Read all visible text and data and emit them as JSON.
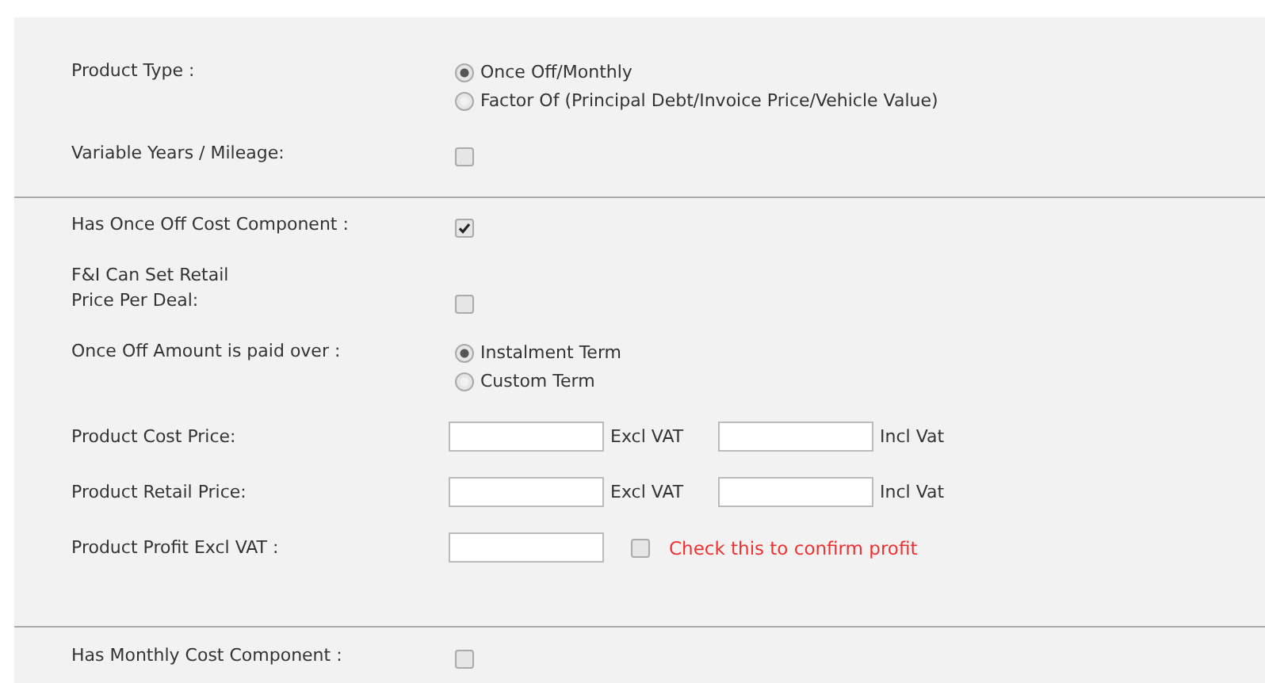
{
  "sections": [
    {
      "rows": [
        {
          "kind": "radio",
          "label": "Product Type :",
          "options": [
            {
              "label": "Once Off/Monthly",
              "selected": true
            },
            {
              "label": "Factor Of (Principal Debt/Invoice Price/Vehicle Value)",
              "selected": false
            }
          ]
        },
        {
          "kind": "checkbox",
          "label": "Variable Years / Mileage:",
          "checked": false
        }
      ]
    },
    {
      "rows": [
        {
          "kind": "checkbox",
          "label": "Has Once Off Cost Component :",
          "checked": true
        },
        {
          "kind": "checkbox",
          "label": "F&I Can Set Retail\nPrice Per Deal:",
          "checked": false
        },
        {
          "kind": "radio",
          "label": "Once Off Amount is paid over :",
          "options": [
            {
              "label": "Instalment Term",
              "selected": true
            },
            {
              "label": "Custom Term",
              "selected": false
            }
          ]
        },
        {
          "kind": "prices",
          "label": "Product Cost Price:",
          "fields": [
            {
              "suffix": "Excl VAT"
            },
            {
              "suffix": "Incl Vat"
            }
          ]
        },
        {
          "kind": "prices",
          "label": "Product Retail Price:",
          "fields": [
            {
              "suffix": "Excl VAT"
            },
            {
              "suffix": "Incl Vat"
            }
          ]
        },
        {
          "kind": "profit",
          "label": "Product Profit Excl VAT :",
          "confirm": {
            "label": "Check this to confirm profit",
            "checked": false
          }
        }
      ]
    },
    {
      "rows": [
        {
          "kind": "checkbox",
          "label": "Has Monthly Cost Component :",
          "checked": false
        }
      ]
    }
  ]
}
